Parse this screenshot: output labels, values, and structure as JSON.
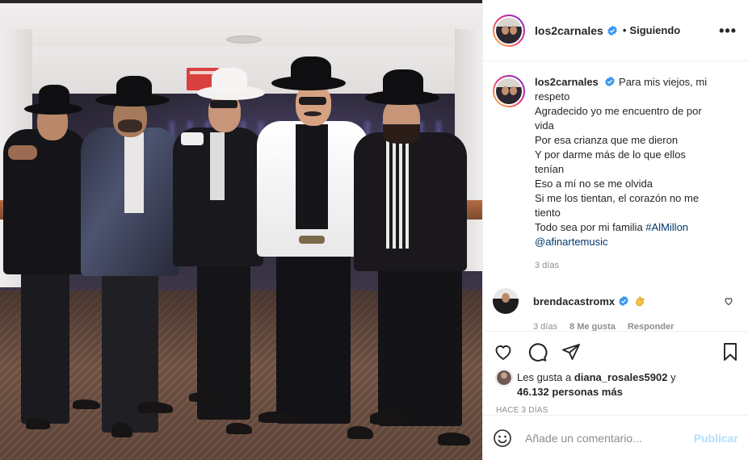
{
  "header": {
    "username": "los2carnales",
    "separator": "•",
    "follow_state": "Siguiendo",
    "more": "•••"
  },
  "post": {
    "caption_user": "los2carnales",
    "caption_lines": [
      "Para mis viejos, mi",
      "respeto",
      "Agradecido yo me encuentro de por",
      "vida",
      "Por esa crianza que me dieron",
      "Y por darme más de lo que ellos",
      "tenían",
      "Eso a mí no se me olvida",
      "Si me los tientan, el corazón no me",
      "tiento"
    ],
    "caption_last_prefix": "Todo sea por mi familia ",
    "hashtag": "#AlMillon",
    "mention": "@afinartemusic",
    "time_ago": "3 días"
  },
  "comment": {
    "username": "brendacastromx",
    "emoji": "clapping-hands-emoji",
    "time_ago": "3 días",
    "likes": "8 Me gusta",
    "reply": "Responder"
  },
  "likes": {
    "prefix": "Les gusta a ",
    "user": "diana_rosales5902",
    "middle": " y",
    "count": "46.132 personas más"
  },
  "timestamp": "HACE 3 DÍAS",
  "add_comment": {
    "placeholder": "Añade un comentario...",
    "publish": "Publicar"
  },
  "colors": {
    "verified": "#3897f0",
    "link": "#00376b",
    "publish_disabled": "#b2dffc",
    "muted": "#8e8e8e"
  }
}
